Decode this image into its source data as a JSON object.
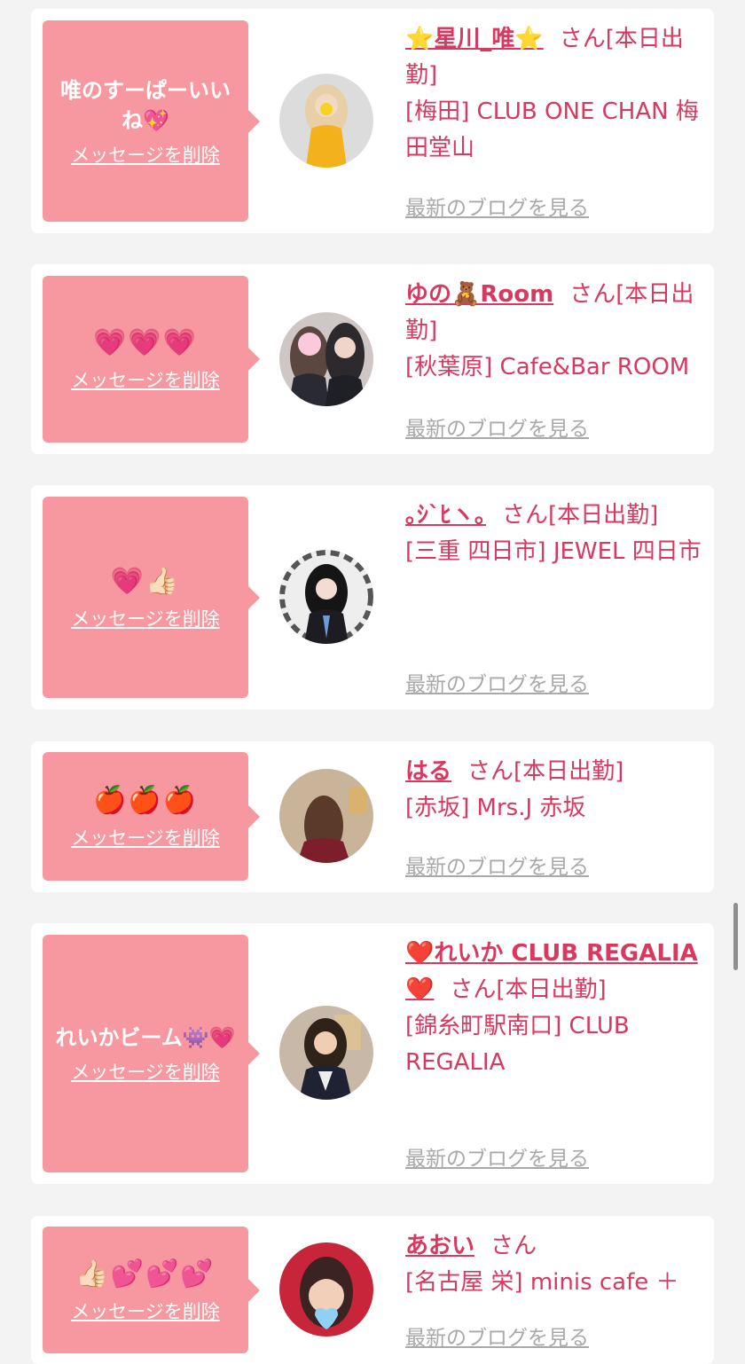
{
  "colors": {
    "page_bg": "#f3f3f3",
    "card_bg": "#ffffff",
    "bubble_bg": "#f7979f",
    "accent_pink": "#d9385f",
    "blog_link_gray": "#a9a9a9"
  },
  "entries": [
    {
      "message": "唯のすーぱーいいね💖",
      "delete_label": "メッセージを削除",
      "name": "⭐星川_唯⭐",
      "suffix": "さん[本日出勤]",
      "shop": "[梅田] CLUB ONE CHAN 梅田堂山",
      "blog_label": "最新のブログを見る",
      "avatar_icon": "avatar-photo-blonde-yellow-dress"
    },
    {
      "message": "💗💗💗",
      "delete_label": "メッセージを削除",
      "name": "ゆの🧸Room",
      "suffix": "さん[本日出勤]",
      "shop": "[秋葉原] Cafe&Bar ROOM",
      "blog_label": "最新のブログを見る",
      "avatar_icon": "avatar-photo-two-girls"
    },
    {
      "message": "💗👍🏻",
      "delete_label": "メッセージを削除",
      "name": "｡ｼ`ﾋヽ｡",
      "suffix": "さん[本日出勤]",
      "shop": "[三重 四日市] JEWEL 四日市",
      "blog_label": "最新のブログを見る",
      "avatar_icon": "avatar-photo-dark-hair-round-frame"
    },
    {
      "message": "🍎🍎🍎",
      "delete_label": "メッセージを削除",
      "name": "はる",
      "suffix": "さん[本日出勤]",
      "shop": "[赤坂] Mrs.J 赤坂",
      "blog_label": "最新のブログを見る",
      "avatar_icon": "avatar-photo-back-view"
    },
    {
      "message": "れいかビーム👾💗",
      "delete_label": "メッセージを削除",
      "name": "❤️れいか CLUB REGALIA❤️",
      "suffix": "さん[本日出勤]",
      "shop": "[錦糸町駅南口] CLUB REGALIA",
      "blog_label": "最新のブログを見る",
      "avatar_icon": "avatar-photo-dark-dress"
    },
    {
      "message": "👍🏻💕💕💕",
      "delete_label": "メッセージを削除",
      "name": "あおい",
      "suffix": "さん",
      "shop": "[名古屋 栄] minis cafe ＋",
      "blog_label": "最新のブログを見る",
      "avatar_icon": "avatar-photo-red-background"
    }
  ]
}
